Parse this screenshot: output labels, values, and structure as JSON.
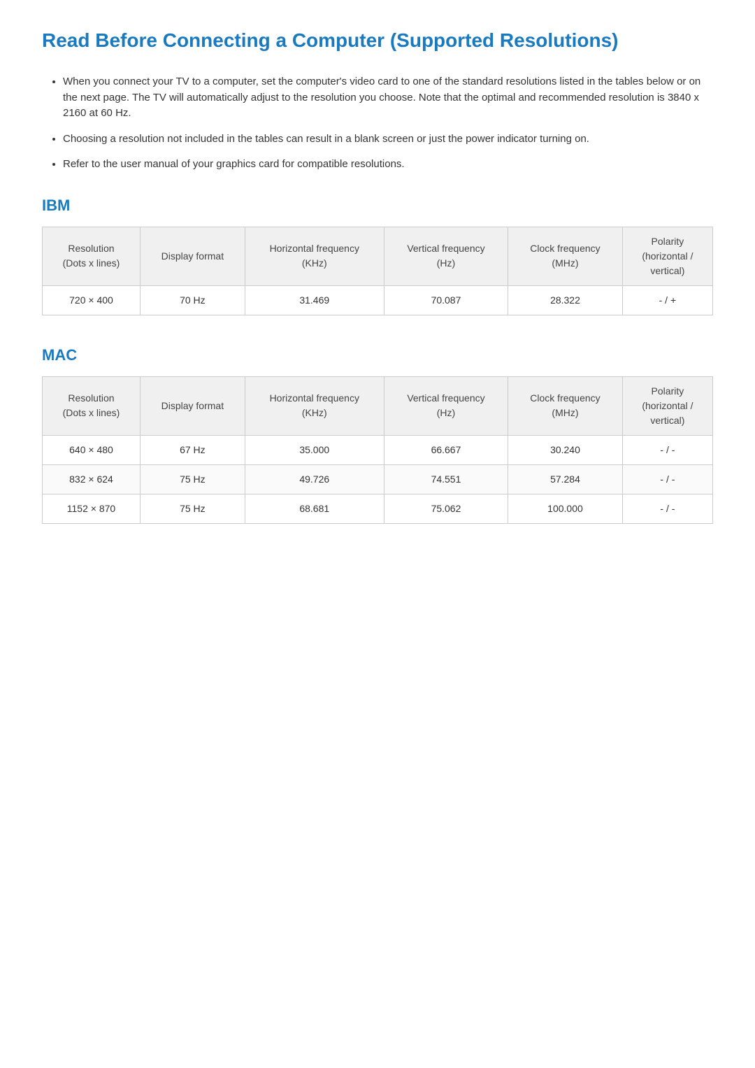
{
  "page": {
    "title": "Read Before Connecting a Computer (Supported Resolutions)"
  },
  "intro": {
    "bullets": [
      "When you connect your TV to a computer, set the computer's video card to one of the standard resolutions listed in the tables below or on the next page. The TV will automatically adjust to the resolution you choose. Note that the optimal and recommended resolution is 3840 x 2160 at 60 Hz.",
      "Choosing a resolution not included in the tables can result in a blank screen or just the power indicator turning on.",
      "Refer to the user manual of your graphics card for compatible resolutions."
    ]
  },
  "ibm": {
    "section_title": "IBM",
    "table": {
      "headers": [
        "Resolution\n(Dots x lines)",
        "Display format",
        "Horizontal frequency\n(KHz)",
        "Vertical frequency\n(Hz)",
        "Clock frequency\n(MHz)",
        "Polarity\n(horizontal /\nvertical)"
      ],
      "rows": [
        {
          "resolution": "720 × 400",
          "display_format": "70 Hz",
          "h_freq": "31.469",
          "v_freq": "70.087",
          "clock": "28.322",
          "polarity": "- / +"
        }
      ]
    }
  },
  "mac": {
    "section_title": "MAC",
    "table": {
      "headers": [
        "Resolution\n(Dots x lines)",
        "Display format",
        "Horizontal frequency\n(KHz)",
        "Vertical frequency\n(Hz)",
        "Clock frequency\n(MHz)",
        "Polarity\n(horizontal /\nvertical)"
      ],
      "rows": [
        {
          "resolution": "640 × 480",
          "display_format": "67 Hz",
          "h_freq": "35.000",
          "v_freq": "66.667",
          "clock": "30.240",
          "polarity": "- / -"
        },
        {
          "resolution": "832 × 624",
          "display_format": "75 Hz",
          "h_freq": "49.726",
          "v_freq": "74.551",
          "clock": "57.284",
          "polarity": "- / -"
        },
        {
          "resolution": "1152 × 870",
          "display_format": "75 Hz",
          "h_freq": "68.681",
          "v_freq": "75.062",
          "clock": "100.000",
          "polarity": "- / -"
        }
      ]
    }
  }
}
